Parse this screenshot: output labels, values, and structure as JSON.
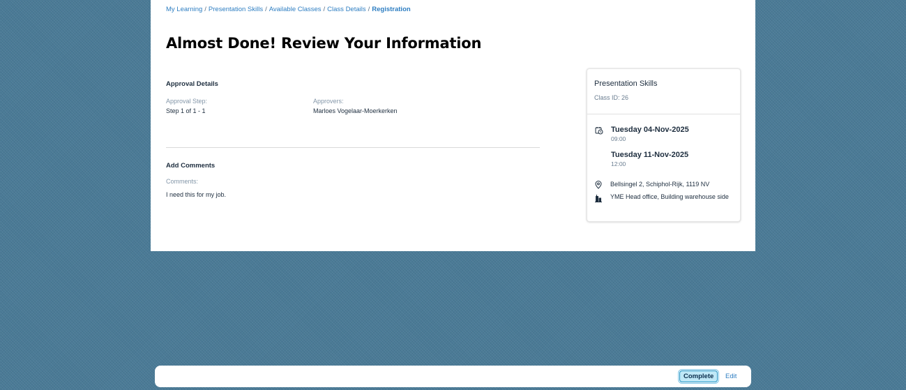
{
  "breadcrumb": {
    "items": [
      "My Learning",
      "Presentation Skills",
      "Available Classes",
      "Class Details"
    ],
    "separator": "/",
    "current": "Registration"
  },
  "page": {
    "title": "Almost Done! Review Your Information"
  },
  "approval": {
    "section_title": "Approval Details",
    "step_label": "Approval Step:",
    "step_value": "Step 1 of 1 - 1",
    "approvers_label": "Approvers:",
    "approvers_value": "Marloes Vogelaar-Moerkerken"
  },
  "comments": {
    "section_title": "Add Comments",
    "label": "Comments:",
    "value": "I need this for my job."
  },
  "class_card": {
    "title": "Presentation Skills",
    "class_id": "Class ID: 26",
    "start_date": "Tuesday 04-Nov-2025",
    "start_time": "09:00",
    "end_date": "Tuesday 11-Nov-2025",
    "end_time": "12:00",
    "address": "Bellsingel 2, Schiphol-Rijk, 1119 NV",
    "facility": "YME Head office, Building warehouse side",
    "icons": {
      "schedule": "calendar-clock-icon",
      "address": "location-pin-icon",
      "facility": "building-icon"
    }
  },
  "footer": {
    "complete_label": "Complete",
    "edit_label": "Edit"
  },
  "colors": {
    "background": "#4a7a96",
    "link": "#2e7ec2",
    "primary_button_bg": "#bfe8f7",
    "primary_button_border": "#1b90c2"
  }
}
